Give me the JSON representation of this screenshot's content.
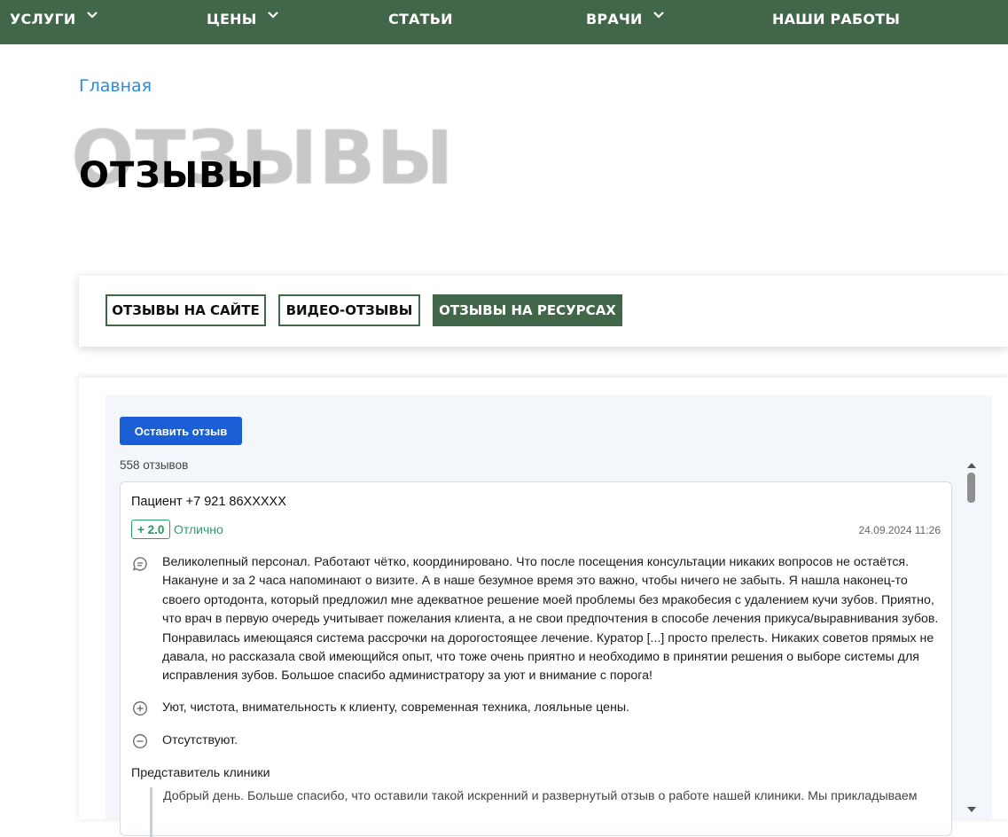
{
  "nav": {
    "items": [
      {
        "label": "УСЛУГИ",
        "has_dropdown": true
      },
      {
        "label": "ЦЕНЫ",
        "has_dropdown": true
      },
      {
        "label": "СТАТЬИ",
        "has_dropdown": false
      },
      {
        "label": "ВРАЧИ",
        "has_dropdown": true
      },
      {
        "label": "НАШИ РАБОТЫ",
        "has_dropdown": false
      }
    ],
    "background": "#42664a"
  },
  "breadcrumb": {
    "home": "Главная"
  },
  "page": {
    "title": "ОТЗЫВЫ",
    "title_shadow": "ОТЗЫВЫ"
  },
  "tabs": [
    {
      "label": "ОТЗЫВЫ НА САЙТЕ",
      "active": false
    },
    {
      "label": "ВИДЕО-ОТЗЫВЫ",
      "active": false
    },
    {
      "label": "ОТЗЫВЫ НА РЕСУРСАХ",
      "active": true
    }
  ],
  "widget": {
    "leave_button": "Оставить отзыв",
    "count": "558 отзывов",
    "review": {
      "author": "Пациент +7 921 86XXXXX",
      "rating": "+ 2.0",
      "rating_label": "Отлично",
      "date": "24.09.2024 11:26",
      "comment": "Великолепный персонал. Работают чётко, координировано. Что после посещения консультации никаких вопросов не остаётся. Накануне и за 2 часа напоминают о визите. А в наше безумное время это важно, чтобы ничего не забыть. Я нашла наконец-то своего ортодонта, который предложил мне адекватное решение моей проблемы без мракобесия с удалением кучи зубов. Приятно, что врач в первую очередь учитывает пожелания клиента, а не свои предпочтения в способе лечения прикуса/выравнивания зубов. Понравилась имеющаяся система рассрочки на дорогостоящее лечение. Куратор [...] просто прелесть. Никаких советов прямых не давала, но рассказала свой имеющийся опыт, что тоже очень приятно и необходимо в принятии решения о выборе системы для исправления зубов. Большое спасибо администратору за уют и внимание с порога!",
      "pros": "Уют, чистота, внимательность к клиенту, современная техника, лояльные цены.",
      "cons": "Отсутствуют.",
      "rep_label": "Представитель клиники",
      "reply": "Добрый день. Больше спасибо, что оставили такой искренний и развернутый отзыв о работе нашей клиники. Мы прикладываем"
    }
  },
  "colors": {
    "accent": "#42664a",
    "link": "#2a8bd8",
    "button": "#1a5fd6",
    "rating": "#2aa06a"
  }
}
